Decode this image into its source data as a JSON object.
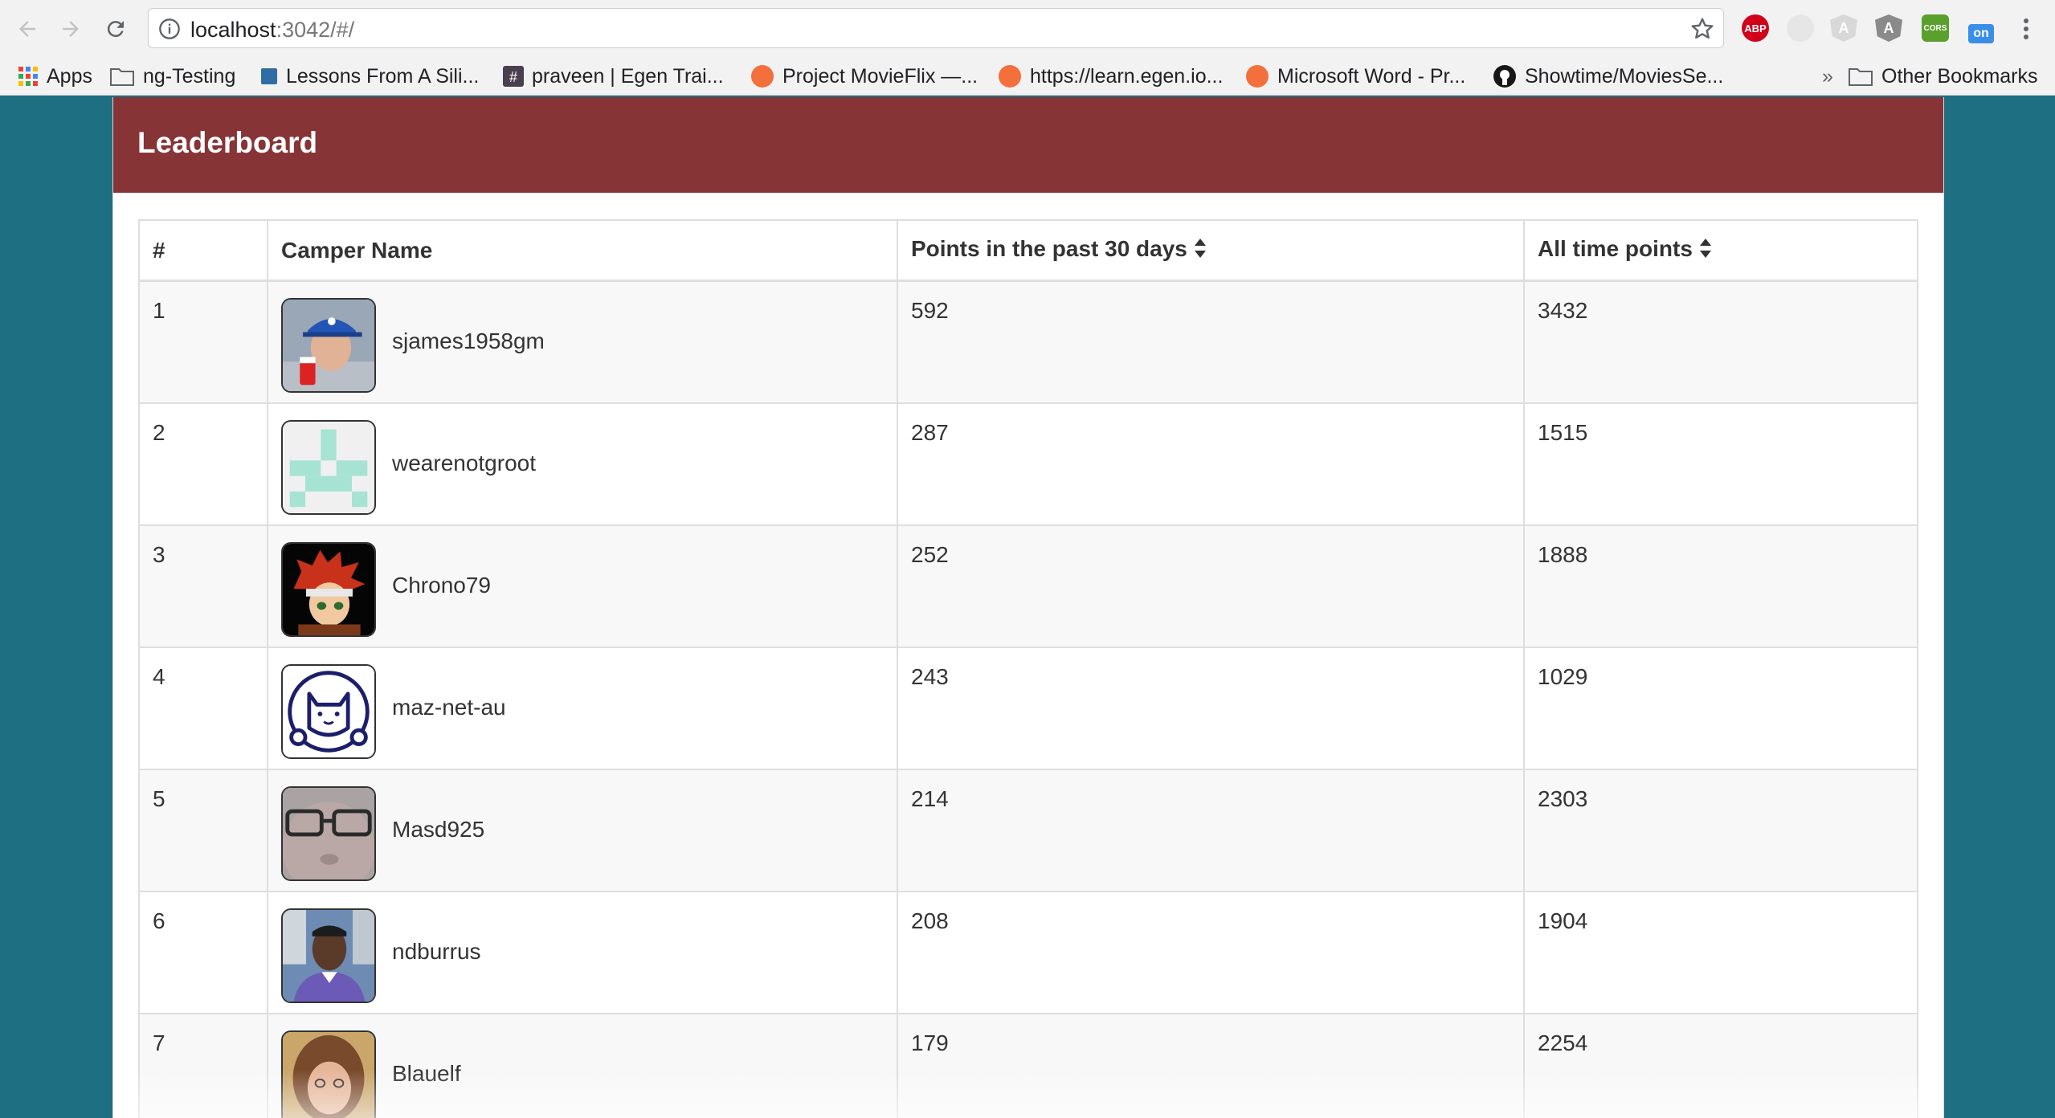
{
  "browser": {
    "url_host": "localhost",
    "url_rest": ":3042/#/",
    "extensions": [
      "ABP",
      "CORS",
      "on"
    ],
    "bookmarks": [
      {
        "label": "Apps",
        "icon": "apps-grid-icon"
      },
      {
        "label": "ng-Testing",
        "icon": "folder-icon"
      },
      {
        "label": "Lessons From A Sili...",
        "icon": "square-icon"
      },
      {
        "label": "praveen | Egen Trai...",
        "icon": "hash-icon"
      },
      {
        "label": "Project MovieFlix —...",
        "icon": "egen-icon"
      },
      {
        "label": "https://learn.egen.io...",
        "icon": "egen-icon"
      },
      {
        "label": "Microsoft Word - Pr...",
        "icon": "egen-icon"
      },
      {
        "label": "Showtime/MoviesSe...",
        "icon": "github-icon"
      }
    ],
    "overflow": "»",
    "other_bookmarks": "Other Bookmarks"
  },
  "page": {
    "title": "Leaderboard",
    "columns": [
      "#",
      "Camper Name",
      "Points in the past 30 days",
      "All time points"
    ],
    "rows": [
      {
        "rank": "1",
        "name": "sjames1958gm",
        "recent": "592",
        "alltime": "3432",
        "avatar": "avatar-photo-cap"
      },
      {
        "rank": "2",
        "name": "wearenotgroot",
        "recent": "287",
        "alltime": "1515",
        "avatar": "avatar-identicon"
      },
      {
        "rank": "3",
        "name": "Chrono79",
        "recent": "252",
        "alltime": "1888",
        "avatar": "avatar-anime"
      },
      {
        "rank": "4",
        "name": "maz-net-au",
        "recent": "243",
        "alltime": "1029",
        "avatar": "avatar-cat-line"
      },
      {
        "rank": "5",
        "name": "Masd925",
        "recent": "214",
        "alltime": "2303",
        "avatar": "avatar-photo-glasses"
      },
      {
        "rank": "6",
        "name": "ndburrus",
        "recent": "208",
        "alltime": "1904",
        "avatar": "avatar-photo-portrait"
      },
      {
        "rank": "7",
        "name": "Blauelf",
        "recent": "179",
        "alltime": "2254",
        "avatar": "avatar-photo-hair"
      }
    ]
  },
  "colors": {
    "page_bg": "#1f6f82",
    "header_bg": "#873437",
    "row_stripe": "#f8f8f8"
  }
}
